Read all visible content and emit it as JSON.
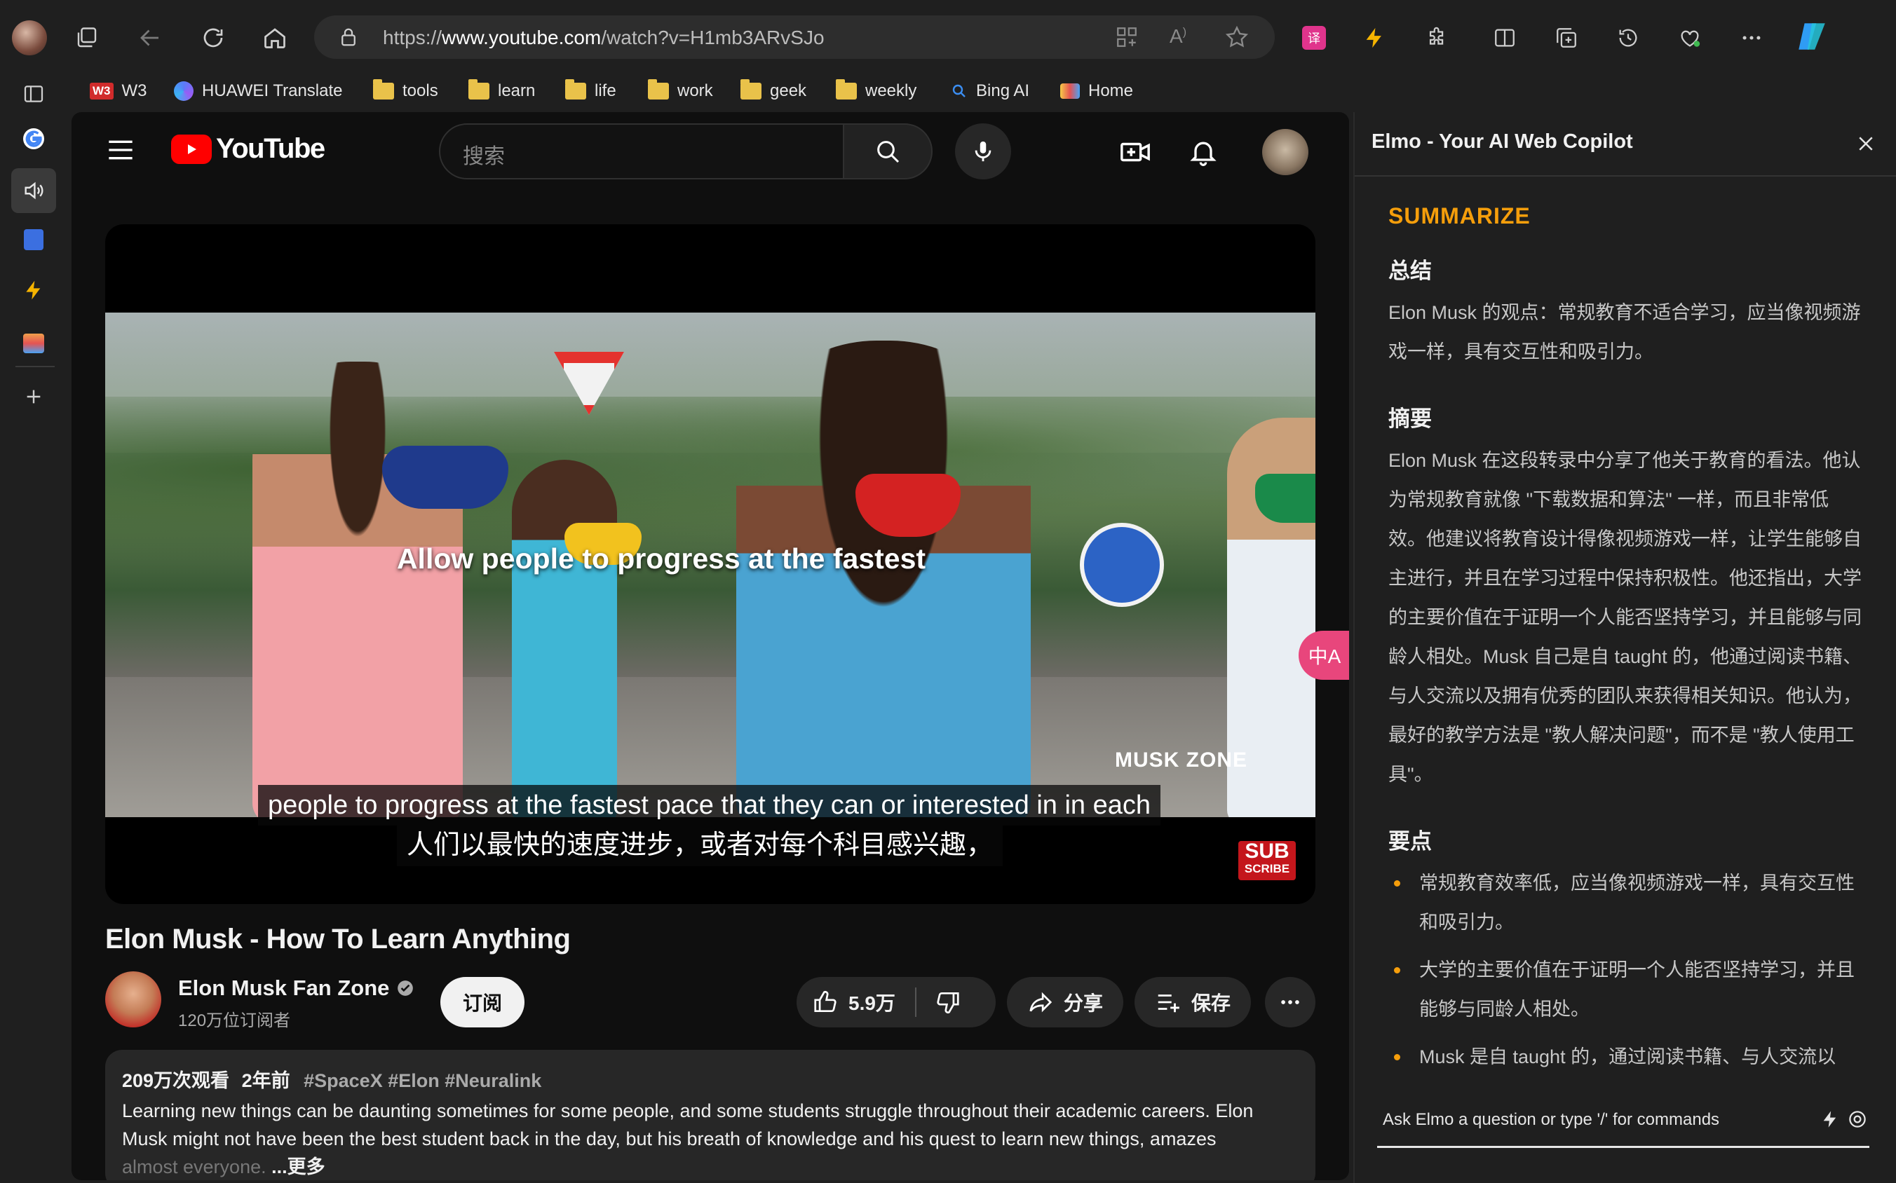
{
  "browser": {
    "url_prefix": "https://",
    "url_domain": "www.youtube.com",
    "url_path": "/watch?v=H1mb3ARvSJo",
    "bookmarks": [
      "W3",
      "HUAWEI Translate",
      "tools",
      "learn",
      "life",
      "work",
      "geek",
      "weekly",
      "Bing AI",
      "Home"
    ],
    "w3_badge": "W3"
  },
  "youtube": {
    "logo_text": "YouTube",
    "search_placeholder": "搜索",
    "video": {
      "overlay_text": "Allow people to progress at the fastest",
      "watermark": "MUSK ZONE",
      "subscribe_badge_1": "SUB",
      "subscribe_badge_2": "SCRIBE",
      "caption_en": "people to progress at the fastest pace that they can or interested in in each",
      "caption_zh": "人们以最快的速度进步，或者对每个科目感兴趣，",
      "translate_badge": "中A"
    },
    "title": "Elon Musk - How To Learn Anything",
    "channel": {
      "name": "Elon Musk Fan Zone",
      "subscribers": "120万位订阅者",
      "subscribe_label": "订阅"
    },
    "actions": {
      "likes": "5.9万",
      "share": "分享",
      "save": "保存"
    },
    "description": {
      "views": "209万次观看",
      "age": "2年前",
      "tags": "#SpaceX #Elon #Neuralink",
      "text_line1": "Learning new things can be daunting sometimes for some people, and some students struggle throughout their academic careers. Elon",
      "text_line2": "Musk might not have been the best student back in the day, but his breath of knowledge and his quest to learn new things, amazes",
      "text_line3": "almost everyone.",
      "more": "...更多"
    }
  },
  "elmo": {
    "title": "Elmo - Your AI Web Copilot",
    "section": "SUMMARIZE",
    "h_summary": "总结",
    "summary": "Elon Musk 的观点：常规教育不适合学习，应当像视频游戏一样，具有交互性和吸引力。",
    "h_abstract": "摘要",
    "abstract": "Elon Musk 在这段转录中分享了他关于教育的看法。他认为常规教育就像 \"下载数据和算法\" 一样，而且非常低效。他建议将教育设计得像视频游戏一样，让学生能够自主进行，并且在学习过程中保持积极性。他还指出，大学的主要价值在于证明一个人能否坚持学习，并且能够与同龄人相处。Musk 自己是自 taught 的，他通过阅读书籍、与人交流以及拥有优秀的团队来获得相关知识。他认为，最好的教学方法是 \"教人解决问题\"，而不是 \"教人使用工具\"。",
    "h_points": "要点",
    "points": [
      "常规教育效率低，应当像视频游戏一样，具有交互性和吸引力。",
      "大学的主要价值在于证明一个人能否坚持学习，并且能够与同龄人相处。",
      "Musk 是自 taught 的，通过阅读书籍、与人交流以"
    ],
    "input_placeholder": "Ask Elmo a question or type '/' for commands"
  },
  "colors": {
    "youtube_red": "#ff0000",
    "elmo_accent": "#f59e0b",
    "folder": "#e9c24a"
  }
}
